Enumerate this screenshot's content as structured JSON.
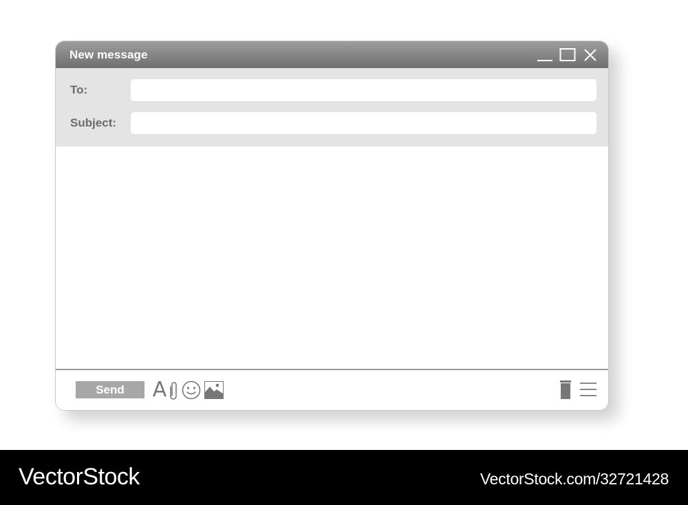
{
  "window": {
    "title": "New message",
    "controls": [
      "minimize-icon",
      "maximize-icon",
      "close-icon"
    ]
  },
  "fields": {
    "to_label": "To:",
    "to_value": "",
    "subject_label": "Subject:",
    "subject_value": ""
  },
  "message_body": "",
  "toolbar": {
    "send_label": "Send",
    "font_icon_glyph": "A",
    "icons": [
      "font-format-icon",
      "attachment-icon",
      "emoji-icon",
      "image-icon",
      "trash-icon",
      "menu-icon"
    ]
  },
  "watermark": {
    "brand": "VectorStock",
    "url": "VectorStock.com/32721428"
  },
  "colors": {
    "titlebar_top": "#9e9e9e",
    "titlebar_bottom": "#6f6f6f",
    "header_bg": "#e4e4e4",
    "send_button": "#a7a7a7",
    "icon": "#777777",
    "footer_bar": "#000000"
  }
}
